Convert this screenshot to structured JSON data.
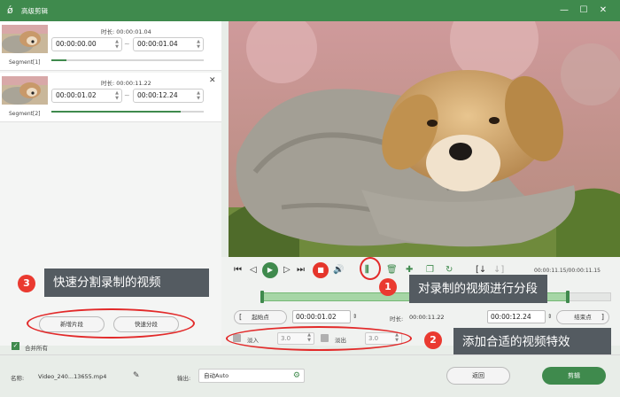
{
  "window": {
    "title": "高级剪辑",
    "min": "—",
    "max": "☐",
    "close": "✕"
  },
  "segments": [
    {
      "name": "Segment[1]",
      "duration_label": "时长:",
      "duration": "00:00:01.04",
      "start": "00:00:00.00",
      "end": "00:00:01.04",
      "progress": 0.1
    },
    {
      "name": "Segment[2]",
      "duration_label": "时长:",
      "duration": "00:00:11.22",
      "start": "00:00:01.02",
      "end": "00:00:12.24",
      "progress": 0.85
    }
  ],
  "segment_tilde": "~",
  "segment_close": "✕",
  "player": {
    "time_display": "00:00:11.15/00:00:11.15"
  },
  "clip": {
    "start_point_label": "起始点",
    "start_time": "00:00:01.02",
    "duration_label": "时长:",
    "duration": "00:00:11.22",
    "end_time": "00:00:12.24",
    "end_point_label": "结束点"
  },
  "effects": {
    "fade_in_label": "淡入",
    "fade_in_value": "3.0",
    "fade_out_label": "淡出",
    "fade_out_value": "3.0"
  },
  "left_buttons": {
    "new_segment": "新增片段",
    "quick_split": "快速分段"
  },
  "merge_all_label": "合并所有",
  "annotations": [
    {
      "num": "1",
      "text": "对录制的视频进行分段"
    },
    {
      "num": "2",
      "text": "添加合适的视频特效"
    },
    {
      "num": "3",
      "text": "快速分割录制的视频"
    }
  ],
  "bottom": {
    "name_label": "名称:",
    "file_name": "Video_240...13655.mp4",
    "output_label": "输出:",
    "output_value": "自动Auto",
    "back_button": "返回",
    "edit_button": "剪辑"
  },
  "colors": {
    "accent": "#3f8a4d",
    "annotation_red": "#ea3a30"
  }
}
